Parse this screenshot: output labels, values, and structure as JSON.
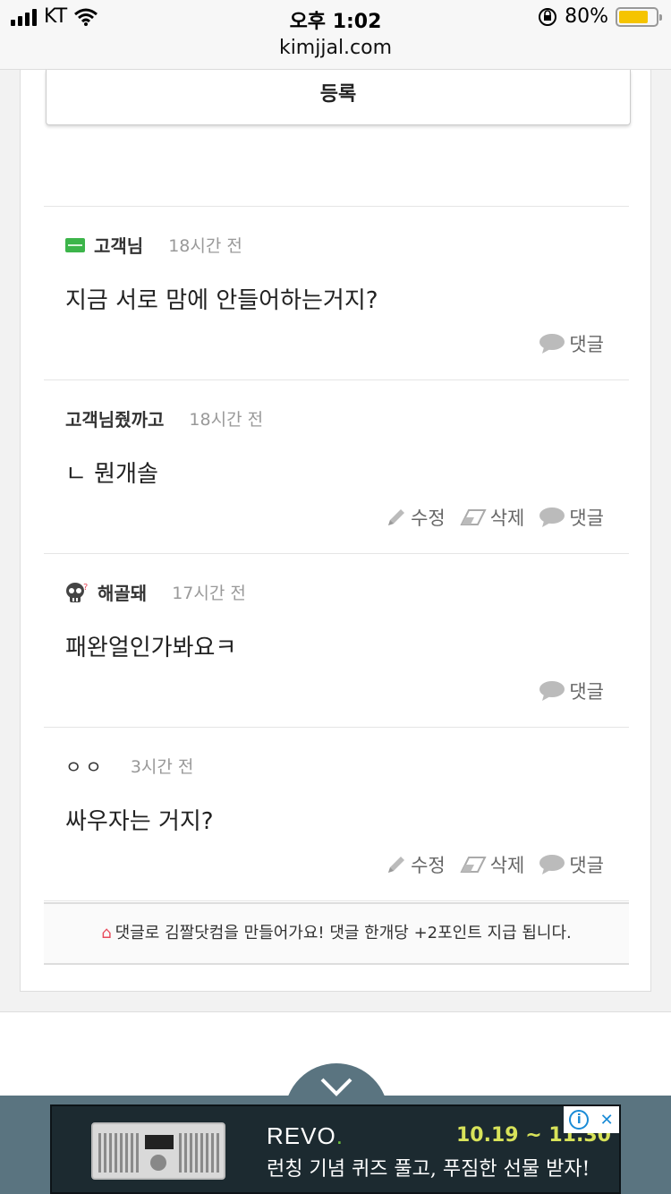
{
  "status": {
    "carrier": "KT",
    "time": "오후 1:02",
    "battery": "80%"
  },
  "browser": {
    "url": "kimjjal.com"
  },
  "form": {
    "submit_label": "등록"
  },
  "labels": {
    "edit": "수정",
    "delete": "삭제",
    "reply": "댓글"
  },
  "comments": [
    {
      "author": "고객님",
      "time": "18시간 전",
      "body": "지금 서로 맘에 안들어하는거지?",
      "icon": "level-badge-icon"
    },
    {
      "author": "고객님줬까고",
      "time": "18시간 전",
      "body": "ㄴ 뭔개솔"
    },
    {
      "author": "해골돼",
      "time": "17시간 전",
      "body": "패완얼인가봐요ㅋ",
      "icon": "skull-icon"
    },
    {
      "author": "ㅇㅇ",
      "time": "3시간 전",
      "body": "싸우자는 거지?"
    }
  ],
  "notice": {
    "text": "댓글로 김짤닷컴을 만들어가요! 댓글 한개당 +2포인트 지급 됩니다."
  },
  "ad": {
    "brand": "REVO",
    "dates": "10.19 ~ 11.30",
    "copy": "런칭 기념 퀴즈 풀고, 푸짐한 선물 받자!"
  },
  "colors": {
    "accent_green": "#3cb54a",
    "home_icon": "#e84b5c",
    "ad_bar": "#5a7480"
  }
}
